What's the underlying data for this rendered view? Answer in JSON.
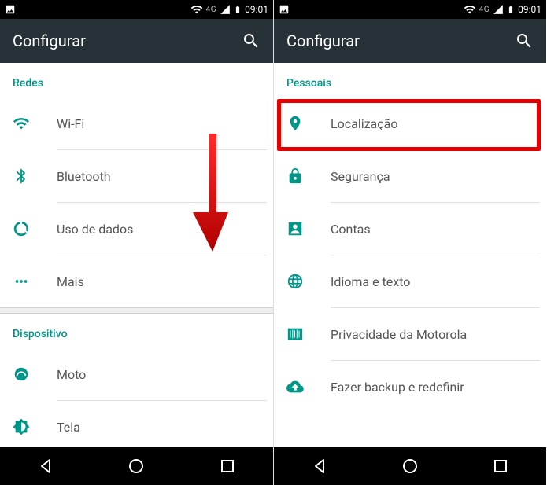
{
  "status": {
    "network": "4G",
    "time": "09:01"
  },
  "appbar": {
    "title": "Configurar"
  },
  "left": {
    "sections": [
      {
        "header": "Redes",
        "items": [
          {
            "icon": "wifi-icon",
            "label": "Wi-Fi"
          },
          {
            "icon": "bluetooth-icon",
            "label": "Bluetooth"
          },
          {
            "icon": "data-usage-icon",
            "label": "Uso de dados"
          },
          {
            "icon": "more-icon",
            "label": "Mais"
          }
        ]
      },
      {
        "header": "Dispositivo",
        "items": [
          {
            "icon": "moto-icon",
            "label": "Moto"
          },
          {
            "icon": "display-icon",
            "label": "Tela"
          }
        ]
      }
    ]
  },
  "right": {
    "sections": [
      {
        "header": "Pessoais",
        "items": [
          {
            "icon": "location-icon",
            "label": "Localização",
            "highlighted": true
          },
          {
            "icon": "security-icon",
            "label": "Segurança"
          },
          {
            "icon": "accounts-icon",
            "label": "Contas"
          },
          {
            "icon": "language-icon",
            "label": "Idioma e texto"
          },
          {
            "icon": "privacy-icon",
            "label": "Privacidade da Motorola"
          },
          {
            "icon": "backup-icon",
            "label": "Fazer backup e redefinir"
          }
        ]
      }
    ]
  },
  "colors": {
    "accent": "#009688",
    "appbar": "#263238",
    "highlight": "#e60000"
  }
}
